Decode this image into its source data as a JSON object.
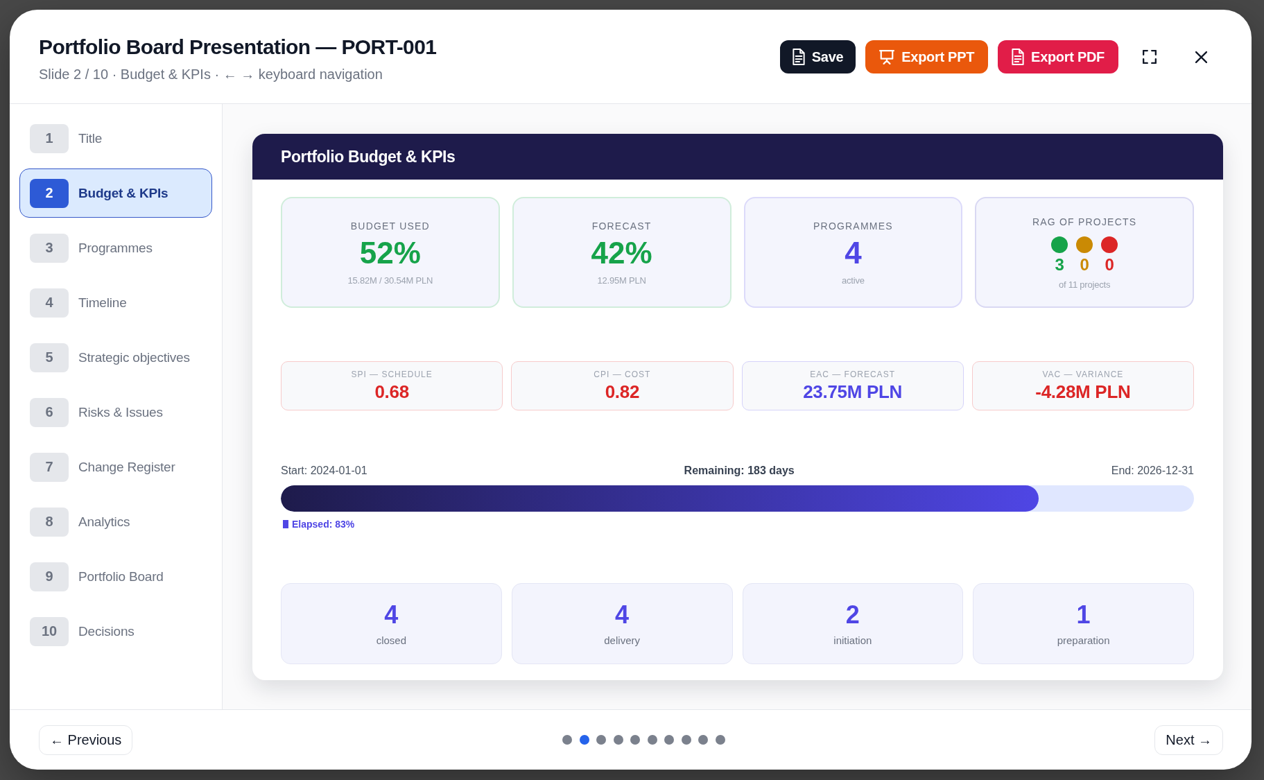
{
  "window": {
    "title": "Portfolio Board Presentation — PORT-001",
    "subtitle": "Slide 2 / 10 · Budget & KPIs · ← → keyboard navigation"
  },
  "toolbar": {
    "buttons": [
      {
        "kind": "save",
        "label": "Save"
      },
      {
        "kind": "ppt",
        "label": "Export PPT"
      },
      {
        "kind": "pdf",
        "label": "Export PDF"
      }
    ]
  },
  "sidebar": {
    "items": [
      {
        "number": "1",
        "label": "Title",
        "selected": false
      },
      {
        "number": "2",
        "label": "Budget & KPIs",
        "selected": true
      },
      {
        "number": "3",
        "label": "Programmes",
        "selected": false
      },
      {
        "number": "4",
        "label": "Timeline",
        "selected": false
      },
      {
        "number": "5",
        "label": "Strategic objectives",
        "selected": false
      },
      {
        "number": "6",
        "label": "Risks & Issues",
        "selected": false
      },
      {
        "number": "7",
        "label": "Change Register",
        "selected": false
      },
      {
        "number": "8",
        "label": "Analytics",
        "selected": false
      },
      {
        "number": "9",
        "label": "Portfolio Board",
        "selected": false
      },
      {
        "number": "10",
        "label": "Decisions",
        "selected": false
      }
    ]
  },
  "slide": {
    "title": "Portfolio Budget & KPIs",
    "kpis": [
      {
        "kind": "metric",
        "label": "BUDGET USED",
        "value": "52%",
        "detail": "15.82M / 30.54M PLN",
        "color": "#16a34a"
      },
      {
        "kind": "metric",
        "label": "FORECAST",
        "value": "42%",
        "detail": "12.95M PLN",
        "color": "#16a34a"
      },
      {
        "kind": "metric",
        "label": "PROGRAMMES",
        "value": "4",
        "detail": "active",
        "color": "#4f46e5"
      },
      {
        "kind": "rag",
        "label": "RAG OF PROJECTS",
        "rag": [
          {
            "color": "#16a34a",
            "count": "3"
          },
          {
            "color": "#ca8a04",
            "count": "0"
          },
          {
            "color": "#dc2626",
            "count": "0"
          }
        ],
        "detail": "of 11 projects"
      }
    ],
    "indicators": [
      {
        "label": "SPI — SCHEDULE",
        "value": "0.68",
        "color": "#dc2626"
      },
      {
        "label": "CPI — COST",
        "value": "0.82",
        "color": "#dc2626"
      },
      {
        "label": "EAC — FORECAST",
        "value": "23.75M PLN",
        "color": "#4f46e5"
      },
      {
        "label": "VAC — VARIANCE",
        "value": "-4.28M PLN",
        "color": "#dc2626"
      }
    ],
    "timeline": {
      "start": "Start: 2024-01-01",
      "remaining": "Remaining: 183 days",
      "end": "End: 2026-12-31",
      "level": 0.83,
      "elapsed": "Elapsed: 83%"
    },
    "stages": [
      {
        "value": "4",
        "label": "closed"
      },
      {
        "value": "4",
        "label": "delivery"
      },
      {
        "value": "2",
        "label": "initiation"
      },
      {
        "value": "1",
        "label": "preparation"
      }
    ]
  },
  "footer": {
    "previous": "← Previous",
    "pages": [
      {
        "selected": false
      },
      {
        "selected": true
      },
      {
        "selected": false
      },
      {
        "selected": false
      },
      {
        "selected": false
      },
      {
        "selected": false
      },
      {
        "selected": false
      },
      {
        "selected": false
      },
      {
        "selected": false
      },
      {
        "selected": false
      }
    ],
    "next": "Next →"
  }
}
